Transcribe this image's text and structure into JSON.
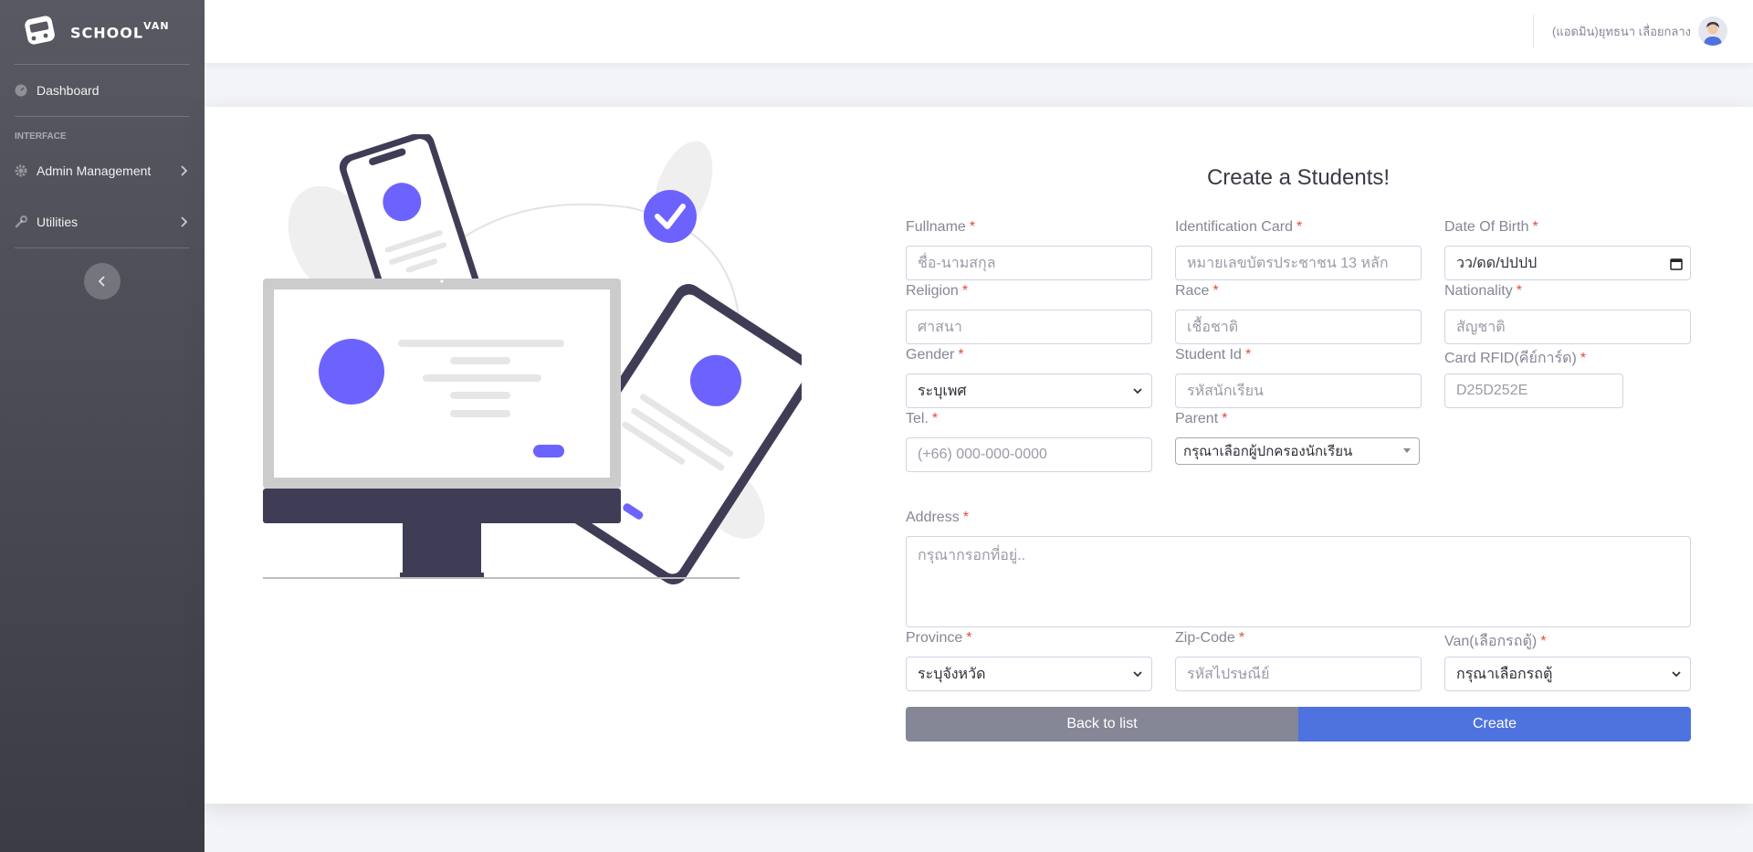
{
  "brand": {
    "name": "SCHOOL",
    "sup": "VAN"
  },
  "sidebar": {
    "dashboard": "Dashboard",
    "section_heading": "INTERFACE",
    "items": [
      {
        "label": "Admin Management"
      },
      {
        "label": "Utilities"
      }
    ]
  },
  "topbar": {
    "user_name": "(แอดมิน)ยุทธนา เลื่อยกลาง"
  },
  "form": {
    "title": "Create a Students!",
    "required_mark": "*",
    "fullname": {
      "label": "Fullname",
      "placeholder": "ชื่อ-นามสกุล"
    },
    "idcard": {
      "label": "Identification Card",
      "placeholder": "หมายเลขบัตรประชาชน 13 หลัก"
    },
    "dob": {
      "label": "Date Of Birth",
      "placeholder": "วว/ดด/ปปปป"
    },
    "religion": {
      "label": "Religion",
      "placeholder": "ศาสนา"
    },
    "race": {
      "label": "Race",
      "placeholder": "เชื้อชาติ"
    },
    "nationality": {
      "label": "Nationality",
      "placeholder": "สัญชาติ"
    },
    "gender": {
      "label": "Gender",
      "value": "ระบุเพศ"
    },
    "student_id": {
      "label": "Student Id",
      "placeholder": "รหัสนักเรียน"
    },
    "rfid": {
      "label": "Card RFID(คีย์การ์ด)",
      "value": "D25D252E"
    },
    "tel": {
      "label": "Tel.",
      "placeholder": "(+66) 000-000-0000"
    },
    "parent": {
      "label": "Parent",
      "value": "กรุณาเลือกผู้ปกครองนักเรียน"
    },
    "address": {
      "label": "Address",
      "placeholder": "กรุณากรอกที่อยู่.."
    },
    "province": {
      "label": "Province",
      "value": "ระบุจังหวัด"
    },
    "zip": {
      "label": "Zip-Code",
      "placeholder": "รหัสไปรษณีย์"
    },
    "van": {
      "label": "Van(เลือกรถตู้)",
      "value": "กรุณาเลือกรถตู้"
    },
    "back_label": "Back to list",
    "create_label": "Create"
  },
  "colors": {
    "primary": "#4e73df",
    "secondary": "#858796",
    "accent": "#6c63ff",
    "danger": "#e74a3b"
  }
}
